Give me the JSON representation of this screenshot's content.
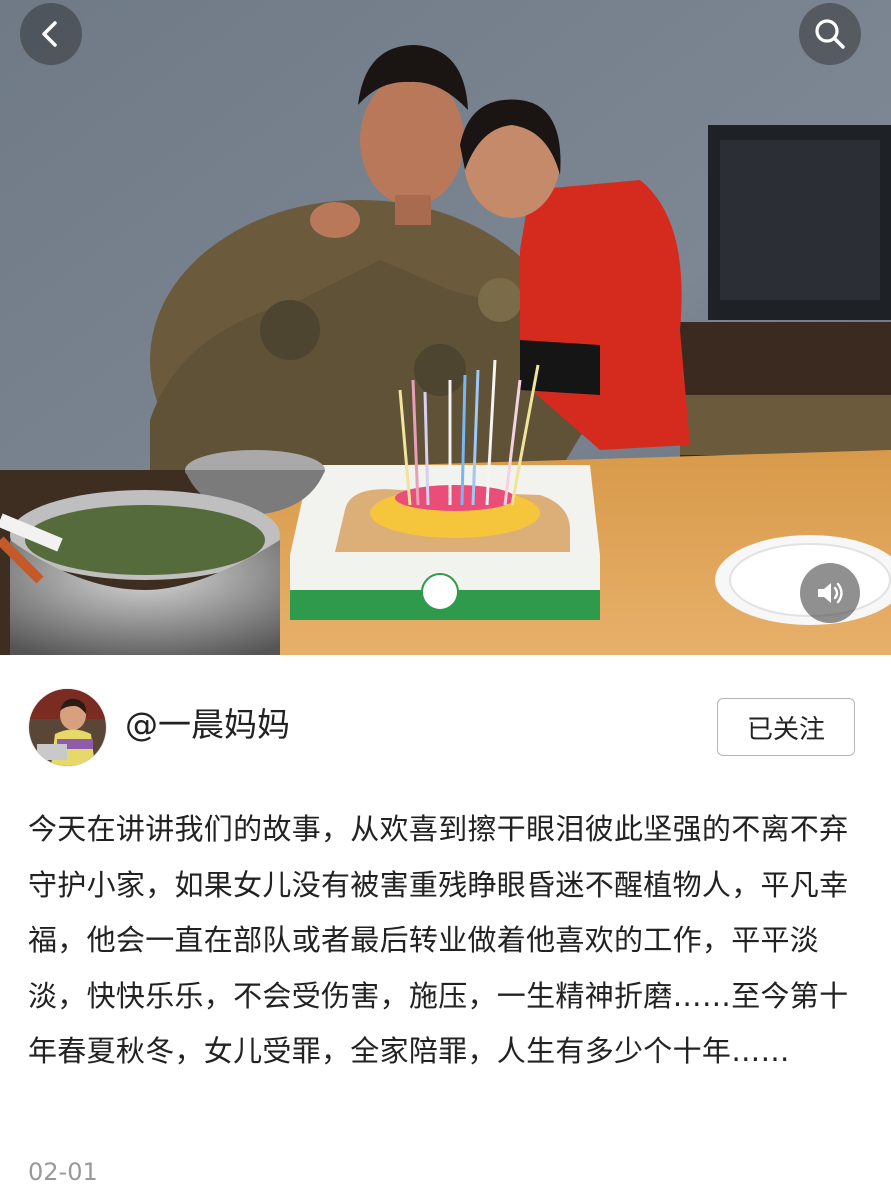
{
  "header": {
    "back_icon": "chevron-left-icon",
    "search_icon": "search-icon"
  },
  "media": {
    "description_icon": "photo",
    "sound_icon": "speaker-icon"
  },
  "author": {
    "name": "@一晨妈妈",
    "follow_label": "已关注"
  },
  "post": {
    "text": "今天在讲讲我们的故事，从欢喜到擦干眼泪彼此坚强的不离不弃守护小家，如果女儿没有被害重残睁眼昏迷不醒植物人，平凡幸福，他会一直在部队或者最后转业做着他喜欢的工作，平平淡淡，快快乐乐，不会受伤害，施压，一生精神折磨……至今第十年春夏秋冬，女儿受罪，全家陪罪，人生有多少个十年……",
    "date": "02-01"
  },
  "colors": {
    "text": "#222222",
    "muted": "#999999",
    "button_border": "#b5b5b5"
  }
}
